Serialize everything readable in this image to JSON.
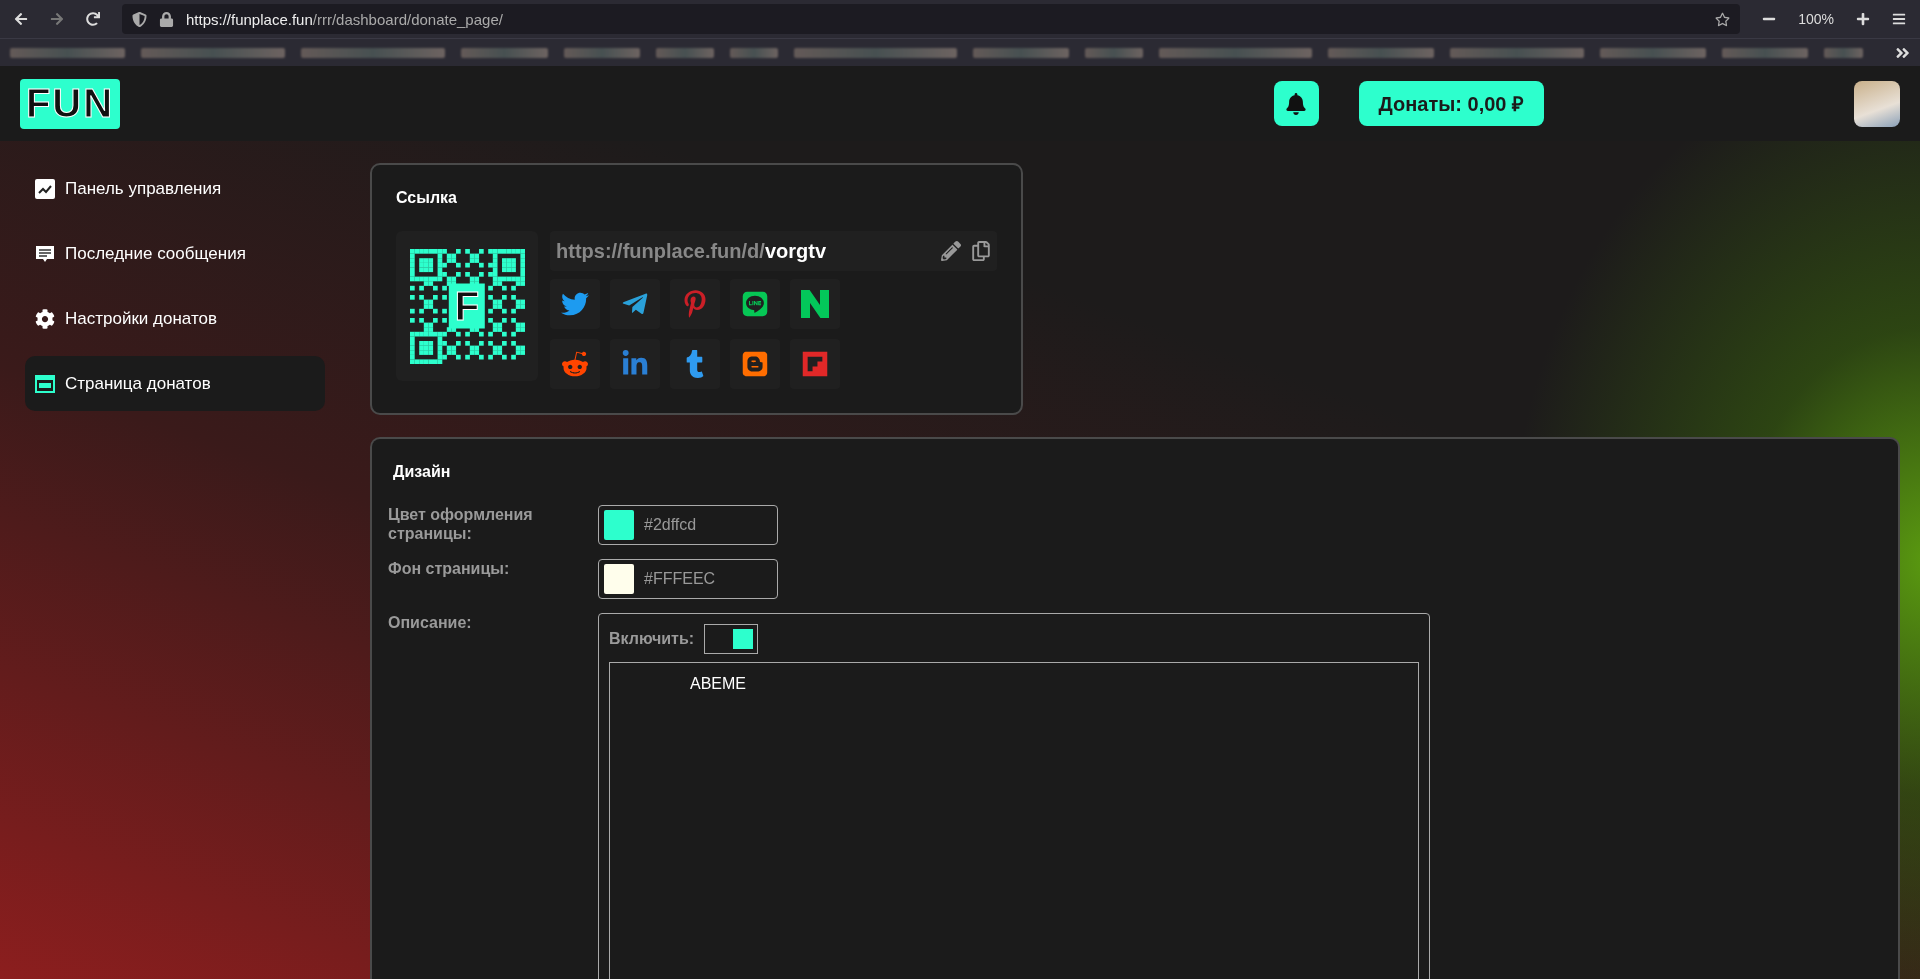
{
  "browser": {
    "url_host": "https://funplace.fun",
    "url_path": "/rrr/dashboard/donate_page/",
    "zoom": "100%"
  },
  "header": {
    "logo": "FUN",
    "donations_button": "Донаты: 0,00 ₽"
  },
  "sidebar": {
    "items": [
      {
        "label": "Панель управления",
        "kind": "chart",
        "selected": false
      },
      {
        "label": "Последние сообщения",
        "kind": "messages",
        "selected": false
      },
      {
        "label": "Настройки донатов",
        "kind": "settings",
        "selected": false
      },
      {
        "label": "Страница донатов",
        "kind": "page",
        "selected": true
      }
    ]
  },
  "link_card": {
    "title": "Ссылка",
    "qr_logo": "F",
    "url_base": "https://funplace.fun/d/",
    "url_slug": "vorgtv",
    "share": [
      {
        "kind": "twitter",
        "color": "#1d9bf0"
      },
      {
        "kind": "telegram",
        "color": "#2aa1da"
      },
      {
        "kind": "pinterest",
        "color": "#cb1f27"
      },
      {
        "kind": "line",
        "color": "#06c755"
      },
      {
        "kind": "naver",
        "color": "#03c75a"
      },
      {
        "kind": "reddit",
        "color": "#ff4500"
      },
      {
        "kind": "linkedin",
        "color": "#2a7fd4"
      },
      {
        "kind": "tumblr",
        "color": "#2f9bf0"
      },
      {
        "kind": "blogger",
        "color": "#ff6d00"
      },
      {
        "kind": "flipboard",
        "color": "#e12828"
      }
    ]
  },
  "design": {
    "title": "Дизайн",
    "fields": [
      {
        "label": "Цвет оформления страницы:",
        "value": "#2dffcd",
        "color": "#2dffcd"
      },
      {
        "label": "Фон страницы:",
        "value": "#FFFEEC",
        "color": "#fffeec"
      }
    ],
    "description": {
      "label": "Описание:",
      "toggle_label": "Включить:",
      "enabled": true,
      "text": "ABEME"
    }
  }
}
